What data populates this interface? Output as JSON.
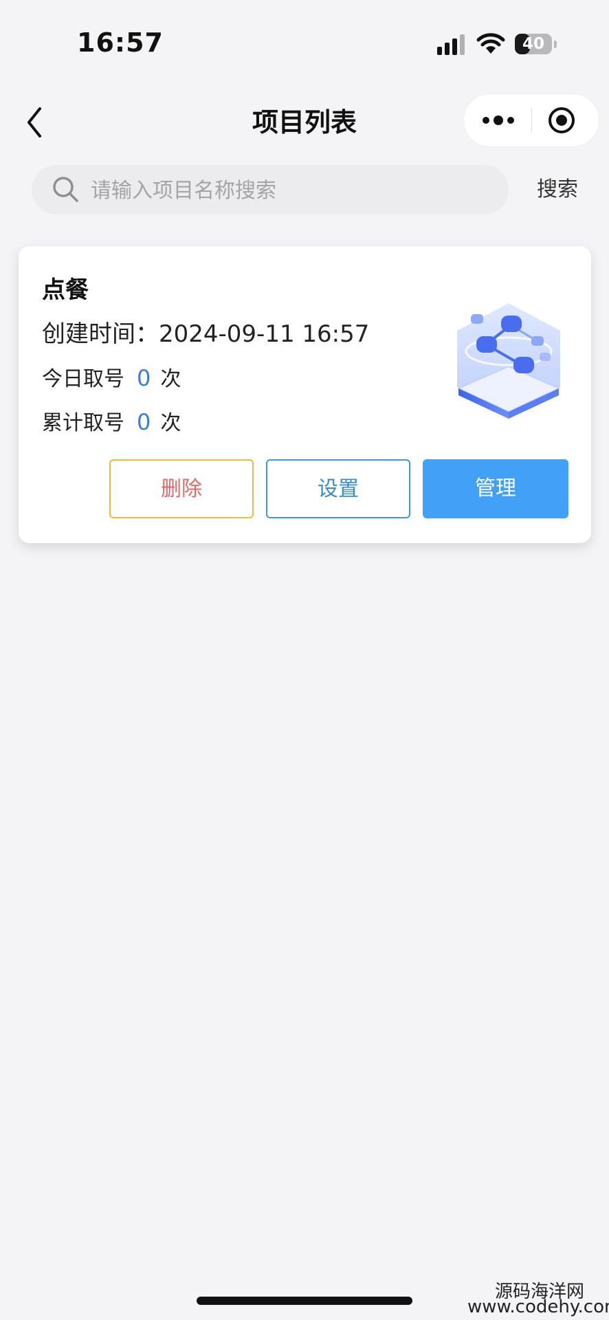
{
  "status_bar": {
    "time": "16:57",
    "battery_level": "40",
    "battery_fraction": 0.4
  },
  "nav": {
    "title": "项目列表",
    "back_icon": "chevron-left-icon",
    "more_icon": "more-dots-icon",
    "target_icon": "target-icon"
  },
  "search": {
    "placeholder": "请输入项目名称搜索",
    "value": "",
    "button_label": "搜索"
  },
  "projects": [
    {
      "name": "点餐",
      "created_label": "创建时间：",
      "created_value": "2024-09-11 16:57",
      "today_label": "今日取号",
      "today_count": "0",
      "total_label": "累计取号",
      "total_count": "0",
      "unit": "次",
      "actions": {
        "delete": "删除",
        "settings": "设置",
        "manage": "管理"
      }
    }
  ],
  "watermark": {
    "name": "源码海洋网",
    "url": "www.codehy.com"
  },
  "colors": {
    "background": "#f4f4f6",
    "primary": "#43a0f7",
    "count_blue": "#3c7fd8",
    "delete_border": "#f2b73b",
    "delete_text": "#e06a6a",
    "settings_border": "#3a9ad8"
  }
}
